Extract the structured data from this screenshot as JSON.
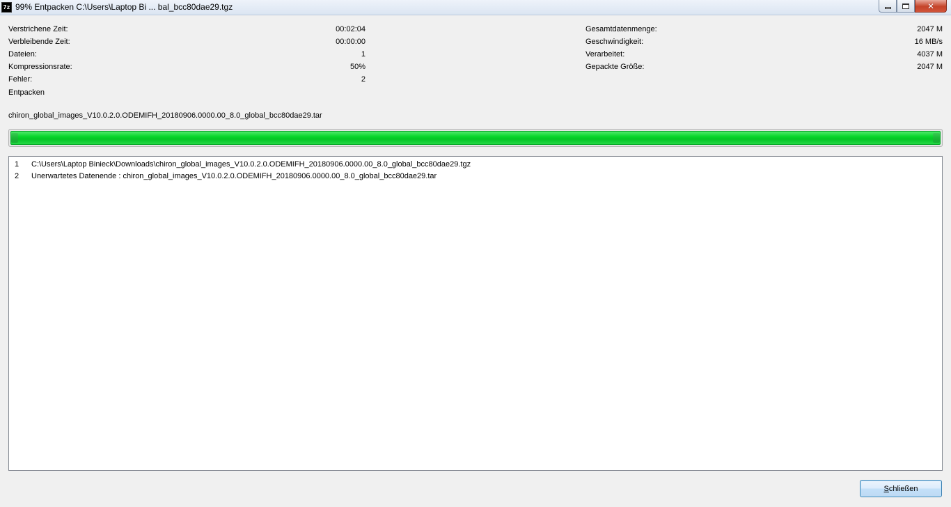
{
  "window": {
    "app_icon_text": "7z",
    "title": "99% Entpacken C:\\Users\\Laptop Bi ... bal_bcc80dae29.tgz",
    "close_glyph": "✕"
  },
  "stats_left": [
    {
      "label": "Verstrichene Zeit:",
      "value": "00:02:04"
    },
    {
      "label": "Verbleibende Zeit:",
      "value": "00:00:00"
    },
    {
      "label": "Dateien:",
      "value": "1"
    },
    {
      "label": "Kompressionsrate:",
      "value": "50%"
    },
    {
      "label": "Fehler:",
      "value": "2"
    }
  ],
  "stats_right": [
    {
      "label": "Gesamtdatenmenge:",
      "value": "2047 M"
    },
    {
      "label": "Geschwindigkeit:",
      "value": "16 MB/s"
    },
    {
      "label": "Verarbeitet:",
      "value": "4037 M"
    },
    {
      "label": "Gepackte Größe:",
      "value": "2047 M"
    }
  ],
  "status": "Entpacken",
  "current_file": "chiron_global_images_V10.0.2.0.ODEMIFH_20180906.0000.00_8.0_global_bcc80dae29.tar",
  "progress_fraction": 0.99,
  "colors": {
    "progress": "#06d62a"
  },
  "messages": [
    {
      "num": "1",
      "text": "C:\\Users\\Laptop Binieck\\Downloads\\chiron_global_images_V10.0.2.0.ODEMIFH_20180906.0000.00_8.0_global_bcc80dae29.tgz"
    },
    {
      "num": "2",
      "text": "Unerwartetes Datenende : chiron_global_images_V10.0.2.0.ODEMIFH_20180906.0000.00_8.0_global_bcc80dae29.tar"
    }
  ],
  "close_button": {
    "accel": "S",
    "rest": "chließen"
  }
}
